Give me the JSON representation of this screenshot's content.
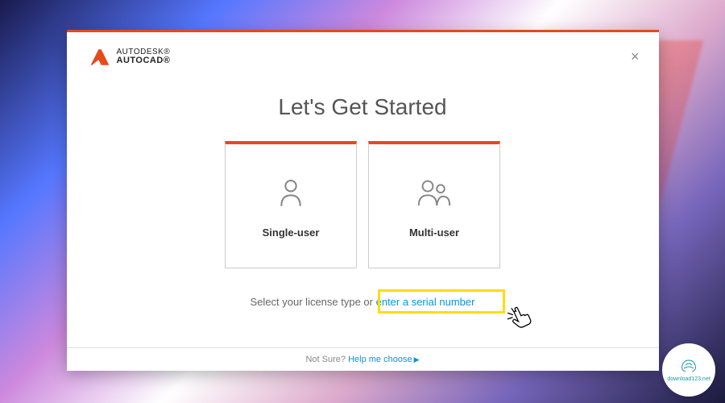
{
  "brand": {
    "line1": "AUTODESK®",
    "line2": "AUTOCAD®"
  },
  "main_title": "Let's Get Started",
  "cards": {
    "single": "Single-user",
    "multi": "Multi-user"
  },
  "prompt": {
    "prefix": "Select your license type or ",
    "link": "enter a serial number"
  },
  "footer": {
    "prefix": "Not Sure? ",
    "link": "Help me choose"
  },
  "site_badge": "download123.net",
  "colors": {
    "accent": "#e64a19",
    "link": "#0696d7",
    "highlight": "#ffdd00"
  }
}
